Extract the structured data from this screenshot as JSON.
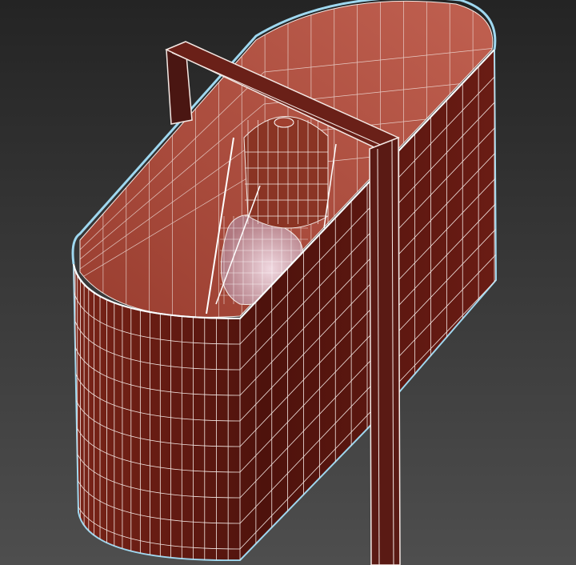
{
  "viewport": {
    "colors": {
      "bg_top": "#242424",
      "bg_bottom": "#4e4e4e",
      "outer_wall": "#5a1610",
      "outer_wall_light": "#7a2418",
      "inner_wall": "#a8483a",
      "inner_wall_light": "#c06050",
      "wire": "#f4e8e4",
      "selection_edge": "#9fd8f0",
      "lamp": "#7a3020",
      "bulb": "#d8b8c0"
    }
  }
}
